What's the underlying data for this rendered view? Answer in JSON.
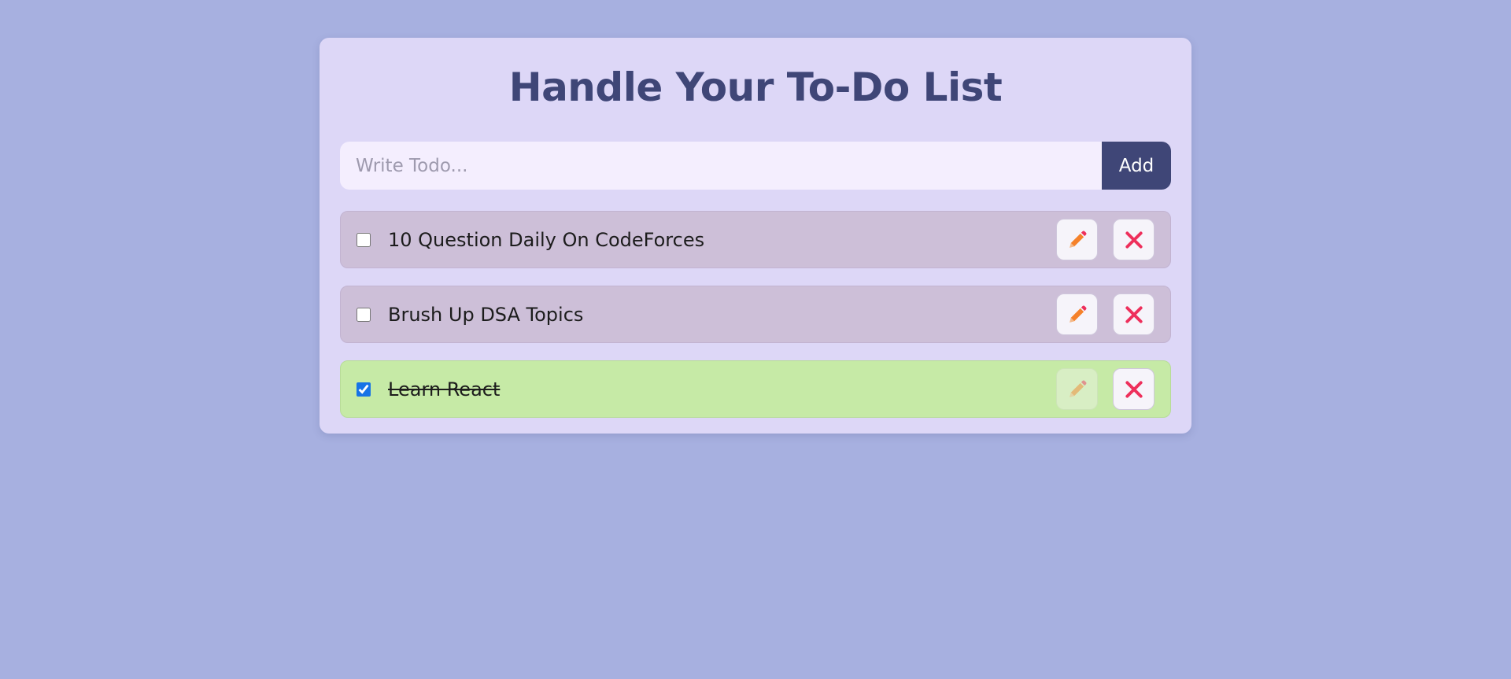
{
  "header": {
    "title": "Handle Your To-Do List"
  },
  "form": {
    "placeholder": "Write Todo...",
    "value": "",
    "add_label": "Add"
  },
  "todos": [
    {
      "text": "10 Question Daily On CodeForces",
      "completed": false
    },
    {
      "text": "Brush Up DSA Topics",
      "completed": false
    },
    {
      "text": "Learn React",
      "completed": true
    }
  ],
  "icons": {
    "edit": "pencil-icon",
    "delete": "close-icon"
  },
  "colors": {
    "page_background": "#a7b0e0",
    "card_background": "#ddd7f7",
    "accent": "#3f4677",
    "pending_item": "#cdbfd8",
    "completed_item": "#c6eaa6",
    "edit_icon": "#f5812a",
    "delete_icon": "#ee2f5b"
  }
}
